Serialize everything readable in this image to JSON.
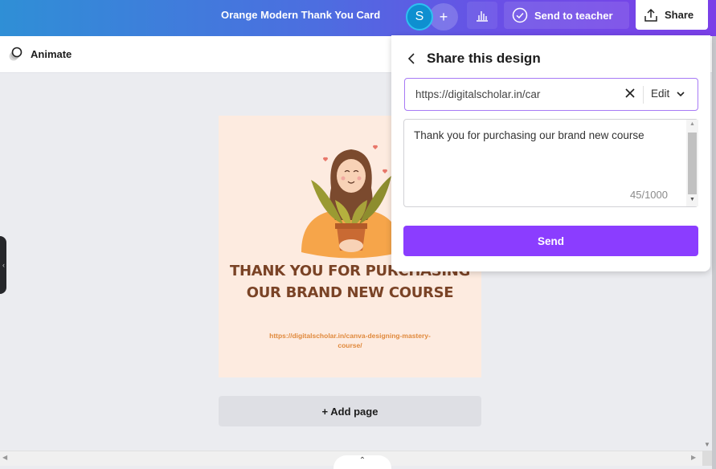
{
  "header": {
    "document_title": "Orange Modern Thank You Card",
    "avatar_initial": "S",
    "add_member_label": "+",
    "send_to_teacher_label": "Send to teacher",
    "share_label": "Share"
  },
  "toolbar": {
    "animate_label": "Animate"
  },
  "design": {
    "headline": "THANK YOU FOR PURCHASING OUR BRAND NEW COURSE",
    "url": "https://digitalscholar.in/canva-designing-mastery-course/",
    "add_page_label": "+ Add page"
  },
  "share_panel": {
    "title": "Share this design",
    "link_value": "https://digitalscholar.in/car",
    "permission": "Edit",
    "message": "Thank you for purchasing our brand new course",
    "char_count": "45/1000",
    "send_label": "Send"
  },
  "colors": {
    "accent": "#8b3dff",
    "card_bg": "#fdebe0",
    "headline": "#7a4326",
    "url_text": "#e0893c"
  }
}
